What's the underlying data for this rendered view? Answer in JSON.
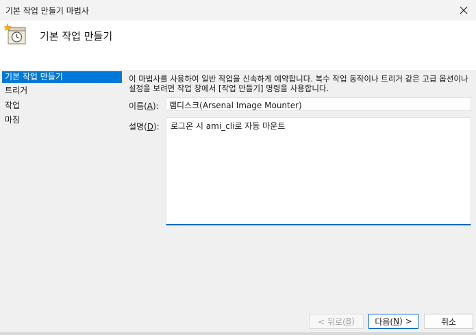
{
  "window": {
    "title": "기본 작업 만들기 마법사"
  },
  "header": {
    "heading": "기본 작업 만들기",
    "icon": "task-scheduler-clock-icon"
  },
  "sidebar": {
    "items": [
      {
        "label": "기본 작업 만들기",
        "active": true
      },
      {
        "label": "트리거",
        "active": false
      },
      {
        "label": "작업",
        "active": false
      },
      {
        "label": "마침",
        "active": false
      }
    ]
  },
  "main": {
    "description": "이 마법사를 사용하여 일반 작업을 신속하게 예약합니다. 복수 작업 동작이나 트리거 같은 고급 옵션이나 설정을 보려면 작업 창에서 [작업 만들기] 명령을 사용합니다.",
    "name_label_prefix": "이름(",
    "name_label_key": "A",
    "name_label_suffix": "):",
    "name_value": "램디스크(Arsenal Image Mounter)",
    "desc_label_prefix": "설명(",
    "desc_label_key": "D",
    "desc_label_suffix": "):",
    "desc_value": "로그온 시 ami_cli로 자동 마운트"
  },
  "buttons": {
    "back_prefix": "< 뒤로(",
    "back_key": "B",
    "back_suffix": ")",
    "next_prefix": "다음(",
    "next_key": "N",
    "next_suffix": ") >",
    "cancel": "취소"
  },
  "colors": {
    "accent": "#0078d7",
    "focus_border": "#0067c0"
  }
}
